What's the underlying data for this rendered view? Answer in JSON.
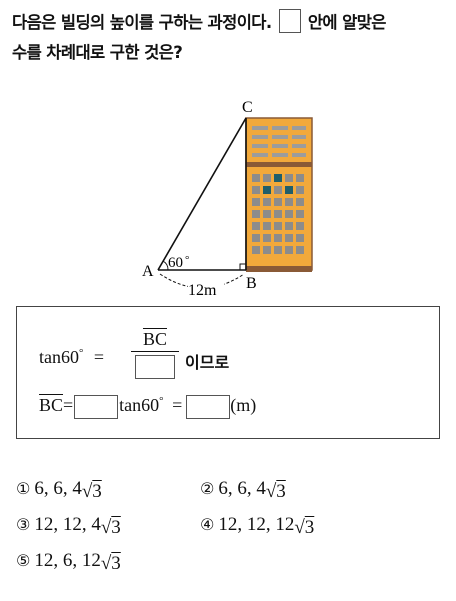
{
  "question": {
    "text_before": "다음은 빌딩의 높이를 구하는 과정이다.",
    "text_after": "안에 알맞은",
    "line2": "수를 차례대로 구한 것은?"
  },
  "figure": {
    "point_a": "A",
    "point_b": "B",
    "point_c": "C",
    "angle_label": "60",
    "degree": "°",
    "distance_label": "12m"
  },
  "solution": {
    "line1_lhs": "tan60",
    "degree": "°",
    "equals": "=",
    "numerator": "BC",
    "line1_suffix": "이므로",
    "line2_lhs": "BC",
    "line2_eq1": "=",
    "line2_mid": "tan60",
    "line2_eq2": "=",
    "line2_unit": "(m)"
  },
  "choices": [
    {
      "marker": "①",
      "text": "6, 6, 4",
      "radicand": "3"
    },
    {
      "marker": "②",
      "text": "6, 6, 4",
      "radicand": "3"
    },
    {
      "marker": "③",
      "text": "12, 12, 4",
      "radicand": "3"
    },
    {
      "marker": "④",
      "text": "12, 12, 12",
      "radicand": "3"
    },
    {
      "marker": "⑤",
      "text": "12, 6, 12",
      "radicand": "3"
    }
  ],
  "colors": {
    "building_body": "#f2a93b",
    "building_frame": "#8a5a36",
    "building_window": "#8c8c8c",
    "building_window_dark": "#1f5e6b"
  }
}
